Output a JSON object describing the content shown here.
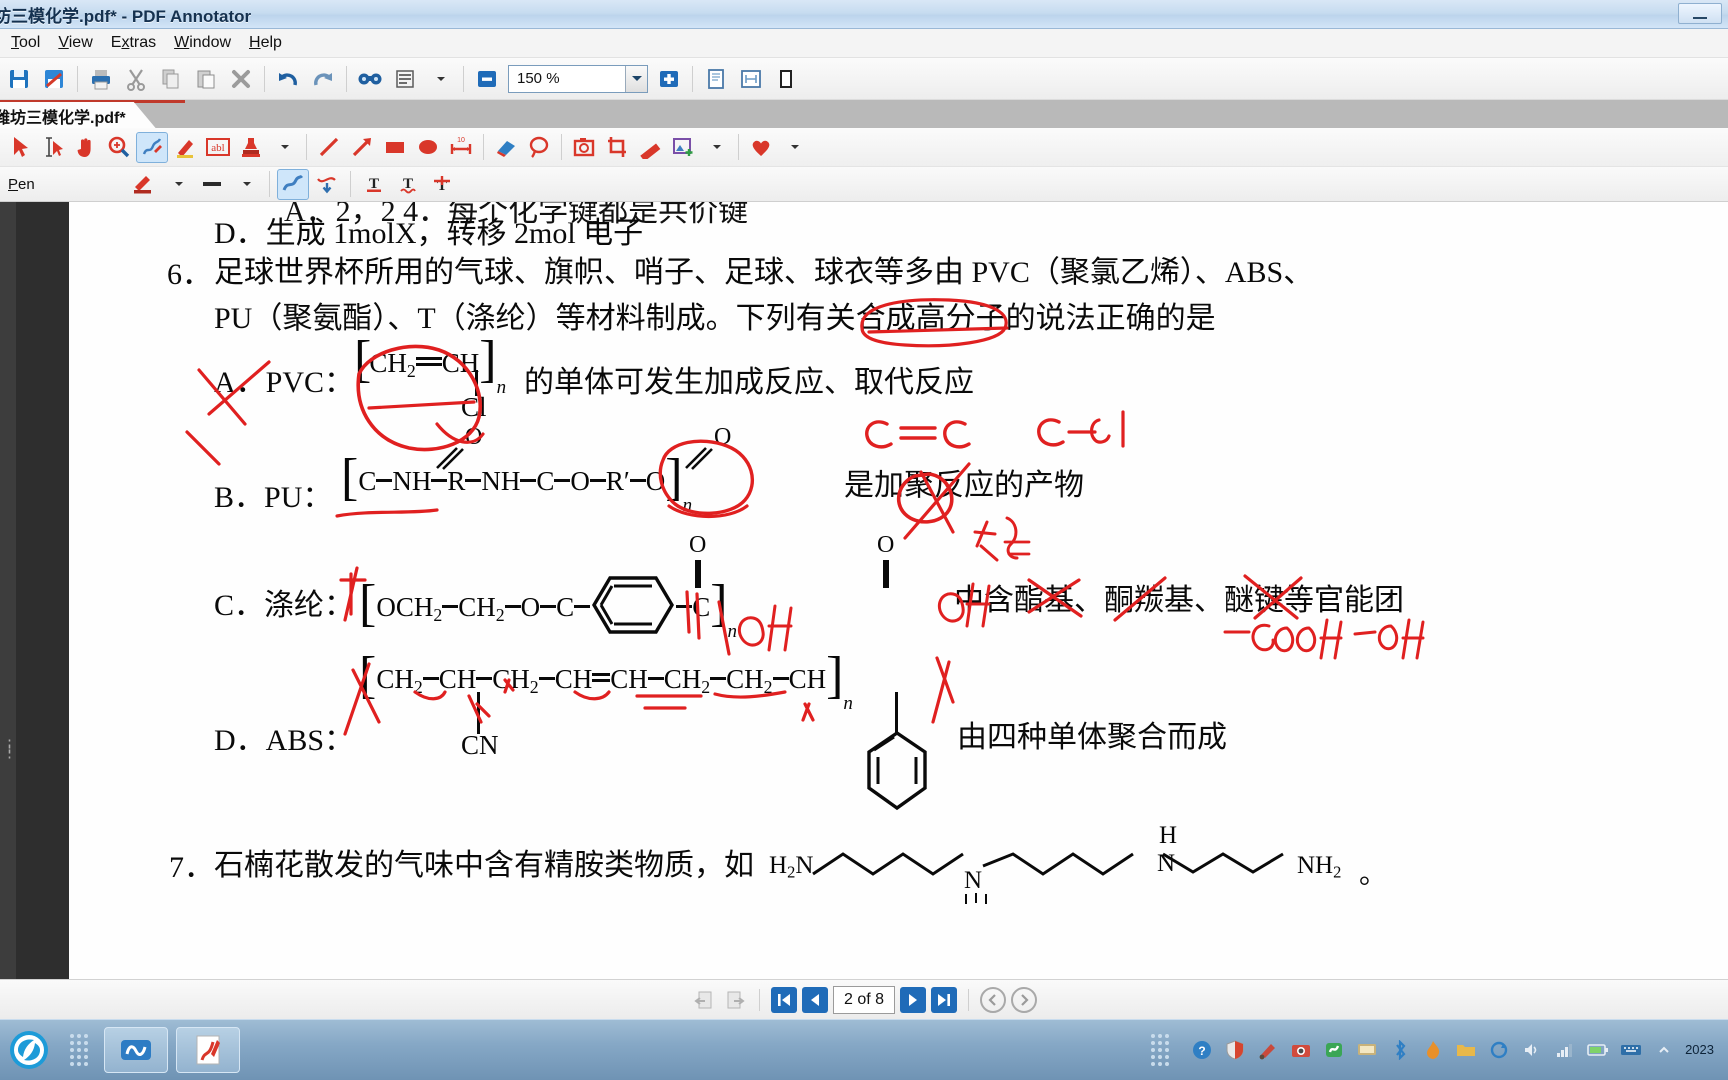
{
  "window": {
    "title": "坊三模化学.pdf* - PDF Annotator",
    "minimize_label": "—"
  },
  "menu": {
    "items": [
      {
        "label": "Tool",
        "accel": "T"
      },
      {
        "label": "View",
        "accel": "V"
      },
      {
        "label": "Extras",
        "accel": "x"
      },
      {
        "label": "Window",
        "accel": "W"
      },
      {
        "label": "Help",
        "accel": "H"
      }
    ]
  },
  "toolbar": {
    "zoom_value": "150 %",
    "buttons": [
      "save-icon",
      "save-as-icon",
      "print-icon",
      "cut-icon",
      "copy-icon",
      "paste-icon",
      "delete-icon",
      "undo-icon",
      "redo-icon",
      "find-icon",
      "page-layout-icon",
      "zoom-out-icon",
      "zoom-in-icon",
      "single-page-icon",
      "fit-page-icon",
      "full-screen-icon"
    ]
  },
  "document_tab": {
    "label": "潍坊三模化学.pdf*"
  },
  "annotation_toolbar": {
    "tools": [
      "arrow-select-icon",
      "text-select-icon",
      "hand-pan-icon",
      "magnifier-icon",
      "pen-icon",
      "highlighter-icon",
      "textbox-icon",
      "stamp-icon",
      "line-icon",
      "arrow-icon",
      "rectangle-icon",
      "ellipse-icon",
      "measure-icon",
      "eraser-icon",
      "lasso-icon",
      "snapshot-icon",
      "crop-icon",
      "ruler-icon",
      "image-icon",
      "favorites-icon"
    ],
    "active_tool": "pen-icon"
  },
  "pen_toolbar": {
    "label": "Pen",
    "controls": [
      "pen-color-icon",
      "pen-width-icon",
      "pressure-pen-icon",
      "smooth-pen-icon",
      "text-top-icon",
      "text-bottom-icon",
      "text-strike-icon"
    ]
  },
  "document": {
    "page_line_d5": "D．生成 1molX，转移 2mol 电子",
    "q6": {
      "number": "6．",
      "line1": "足球世界杯所用的气球、旗帜、哨子、足球、球衣等多由 PVC（聚氯乙烯）、ABS、",
      "line2": "PU（聚氨酯）、T（涤纶）等材料制成。下列有关合成高分子的说法正确的是",
      "options": {
        "a_label": "A．PVC：",
        "a_ch2": "CH",
        "a_ch2_sub": "2",
        "a_ch": "CH",
        "a_cl": "Cl",
        "a_n": "n",
        "a_text": "的单体可发生加成反应、取代反应",
        "b_label": "B．PU：",
        "b_c": "C",
        "b_o1": "O",
        "b_nh1": "NH",
        "b_r": "R",
        "b_nh2": "NH",
        "b_c2": "C",
        "b_o2": "O",
        "b_o3": "O",
        "b_rprime": "R′",
        "b_o4": "O",
        "b_n": "n",
        "b_text": "是加聚反应的产物",
        "c_label": "C．涤纶：",
        "c_och2": "OCH",
        "c_och2_sub": "2",
        "c_ch2": "CH",
        "c_ch2_sub": "2",
        "c_o": "O",
        "c_c1": "C",
        "c_o1": "O",
        "c_c2": "C",
        "c_o2": "O",
        "c_n": "n",
        "c_text": "中含酯基、酮羰基、醚键等官能团",
        "d_label": "D．ABS：",
        "d_ch2a": "CH",
        "d_ch2a_sub": "2",
        "d_cha": "CH",
        "d_cn": "CN",
        "d_ch2b": "CH",
        "d_ch2b_sub": "2",
        "d_chb": "CH",
        "d_chc": "CH",
        "d_ch2c": "CH",
        "d_ch2c_sub": "2",
        "d_ch2d": "CH",
        "d_ch2d_sub": "2",
        "d_chd": "CH",
        "d_n": "n",
        "d_text": "由四种单体聚合而成"
      }
    },
    "q7": {
      "number": "7．",
      "text": "石楠花散发的气味中含有精胺类物质，如",
      "h2n": "H",
      "h2n_sub": "2",
      "h2n_n": "N",
      "nh_mid1": "N",
      "nh_mid2_h": "H",
      "nh_mid2_n": "N",
      "nh2_end": "NH",
      "nh2_end_sub": "2",
      "period": "。"
    },
    "ink_annotations": [
      {
        "name": "c-double-bond-note",
        "text": "C＝C"
      },
      {
        "name": "c-cl-bond-note",
        "text": "C—Cl"
      },
      {
        "name": "suo-correction-note",
        "text": "缩"
      },
      {
        "name": "oh-note-1",
        "text": "OH"
      },
      {
        "name": "oh-note-2",
        "text": "OH"
      },
      {
        "name": "cooh-note",
        "text": "-COOH"
      },
      {
        "name": "oh-note-3",
        "text": "-OH"
      }
    ],
    "ink_color": "#e02020"
  },
  "statusbar": {
    "page_indicator": "2 of 8",
    "buttons": [
      "prev-doc-icon",
      "next-doc-icon",
      "first-page-icon",
      "prev-page-icon",
      "next-page-icon",
      "last-page-icon",
      "back-icon",
      "forward-icon"
    ]
  },
  "taskbar": {
    "start_label": "start-orb",
    "items": [
      "edge-browser",
      "app-blue",
      "pdf-annotator"
    ],
    "tray": [
      "help-icon",
      "shield-icon",
      "paint-icon",
      "camera-icon",
      "app-green-icon",
      "screen-icon",
      "bluetooth-icon",
      "flame-icon",
      "folder-icon",
      "sync-icon",
      "speaker-icon",
      "network-icon",
      "battery-icon",
      "keyboard-icon",
      "chevron-icon"
    ],
    "clock": "2023"
  }
}
